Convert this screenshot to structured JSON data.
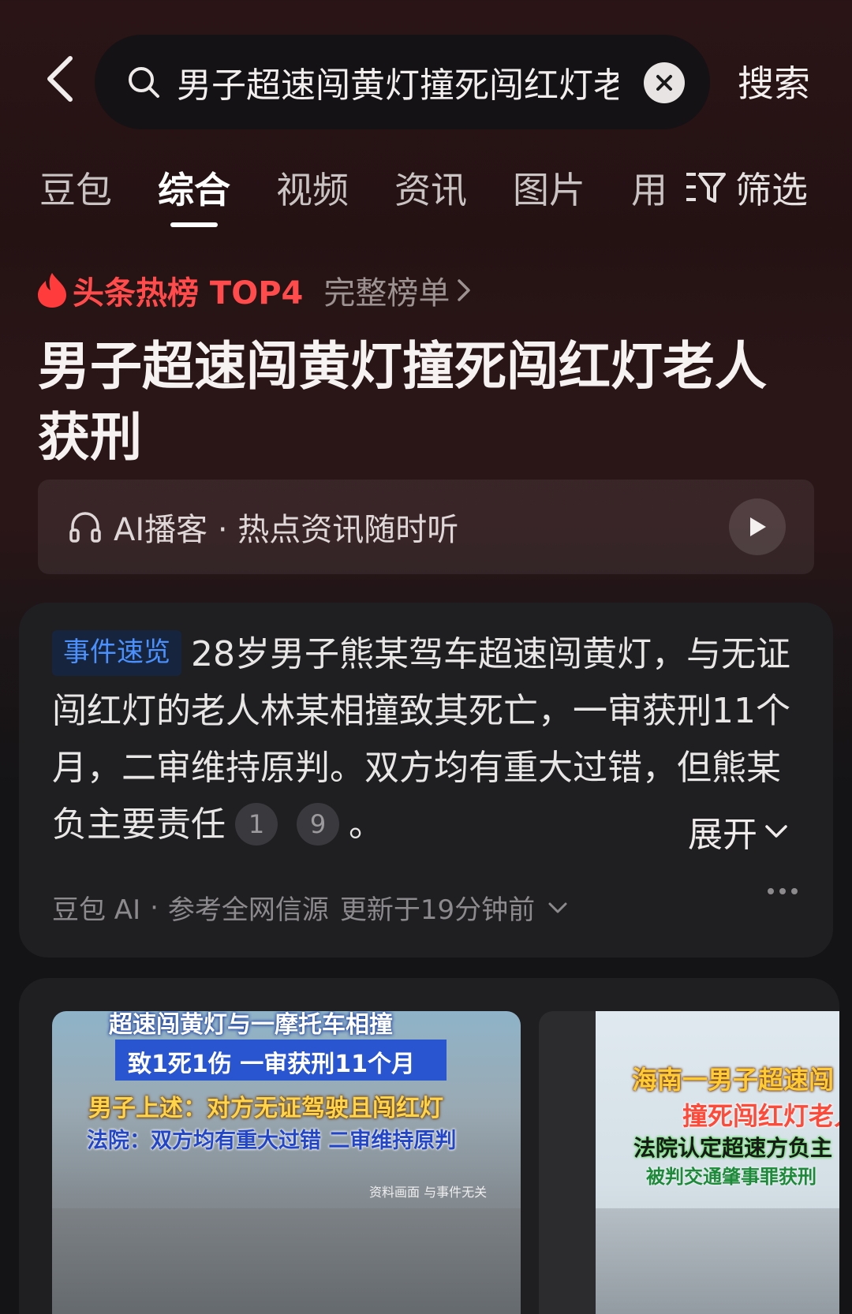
{
  "header": {
    "search_query": "男子超速闯黄灯撞死闯红灯老",
    "search_button": "搜索"
  },
  "tabs": [
    {
      "label": "豆包"
    },
    {
      "label": "综合"
    },
    {
      "label": "视频"
    },
    {
      "label": "资讯"
    },
    {
      "label": "图片"
    },
    {
      "label": "用"
    }
  ],
  "filter_label": "筛选",
  "hot": {
    "label": "头条热榜 TOP4",
    "link": "完整榜单"
  },
  "title": "男子超速闯黄灯撞死闯红灯老人获刑",
  "podcast": {
    "text": "AI播客 · 热点资讯随时听"
  },
  "summary": {
    "badge": "事件速览",
    "text": "28岁男子熊某驾车超速闯黄灯，与无证闯红灯的老人林某相撞致其死亡，一审获刑11个月，二审维持原判。双方均有重大过错，但熊某负主要责任",
    "refs": [
      "1",
      "9"
    ],
    "end": "。",
    "expand_label": "展开",
    "source": "豆包 AI",
    "source_detail": "参考全网信源",
    "updated": "更新于19分钟前"
  },
  "media": {
    "thumb1": {
      "line1": "超速闯黄灯与一摩托车相撞",
      "line2": "致1死1伤 一审获刑11个月",
      "line3": "男子上述：对方无证驾驶且闯红灯",
      "line4": "法院：双方均有重大过错 二审维持原判",
      "note": "资料画面 与事件无关"
    },
    "thumb2": {
      "line1": "海南一男子超速闯",
      "line2": "撞死闯红灯老人",
      "line3": "法院认定超速方负主",
      "line4": "被判交通肇事罪获刑"
    }
  },
  "colors": {
    "hot_red": "#ff4b4b",
    "badge_blue": "#4a90ff",
    "card_bg": "#1f1f22"
  }
}
